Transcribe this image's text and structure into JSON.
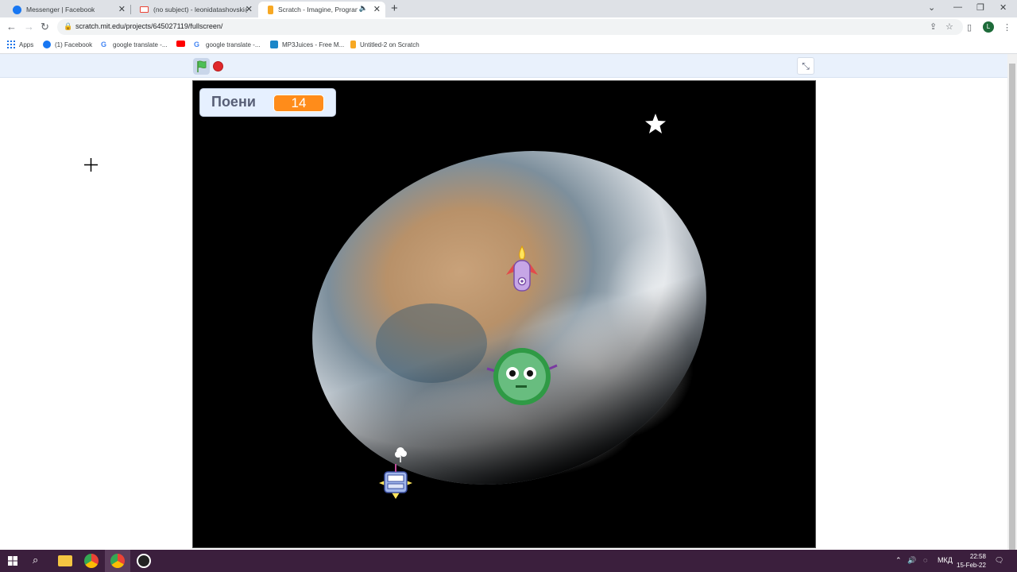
{
  "tabs": [
    {
      "title": "Messenger | Facebook",
      "icon": "facebook-icon"
    },
    {
      "title": "(no subject) - leonidatashovski@",
      "icon": "gmail-icon"
    },
    {
      "title": "Scratch - Imagine, Program,",
      "icon": "scratch-icon"
    }
  ],
  "address": {
    "url": "scratch.mit.edu/projects/645027119/fullscreen/"
  },
  "profile_initial": "L",
  "bookmarks": [
    {
      "label": "Apps",
      "icon": "apps-grid-icon"
    },
    {
      "label": "(1) Facebook",
      "icon": "facebook-icon"
    },
    {
      "label": "google translate -...",
      "icon": "google-icon"
    },
    {
      "label": "",
      "icon": "youtube-icon"
    },
    {
      "label": "google translate -...",
      "icon": "google-icon"
    },
    {
      "label": "MP3Juices - Free M...",
      "icon": "mp3juices-icon"
    },
    {
      "label": "Untitled-2 on Scratch",
      "icon": "scratch-icon"
    }
  ],
  "stage": {
    "variable_label": "Поени",
    "variable_value": "14"
  },
  "taskbar": {
    "language": "МКД",
    "time": "22:58",
    "date": "15-Feb-22"
  },
  "colors": {
    "scratch_orange": "#ff8c1a",
    "stop_red": "#e0282b",
    "green_flag": "#4cbf56",
    "taskbar": "#3b1f3d"
  }
}
